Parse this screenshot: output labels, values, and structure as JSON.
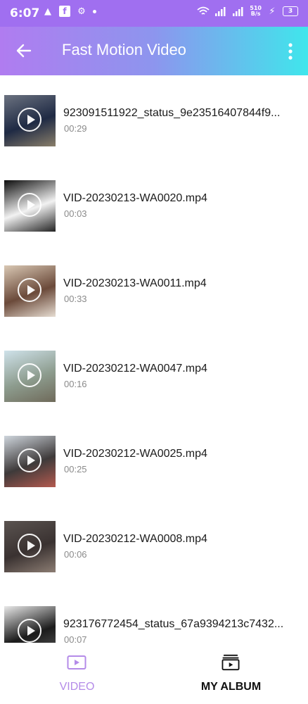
{
  "status_bar": {
    "time": "6:07",
    "net_speed_value": "510",
    "net_speed_unit": "B/s",
    "battery": "3"
  },
  "app_bar": {
    "title": "Fast Motion Video",
    "back_icon": "arrow-left-icon",
    "menu_icon": "more-vertical-icon"
  },
  "videos": [
    {
      "name": "923091511922_status_9e23516407844f9...",
      "duration": "00:29",
      "thumb_colors": [
        "#6b7280",
        "#1f2a44",
        "#8a7f6a"
      ]
    },
    {
      "name": "VID-20230213-WA0020.mp4",
      "duration": "00:03",
      "thumb_colors": [
        "#0d0d0d",
        "#f2f2f2",
        "#222"
      ]
    },
    {
      "name": "VID-20230213-WA0011.mp4",
      "duration": "00:33",
      "thumb_colors": [
        "#d9c8b4",
        "#6b4a3a",
        "#e7ddd2"
      ]
    },
    {
      "name": "VID-20230212-WA0047.mp4",
      "duration": "00:16",
      "thumb_colors": [
        "#cfe2ea",
        "#8d9c8e",
        "#6f6a5a"
      ]
    },
    {
      "name": "VID-20230212-WA0025.mp4",
      "duration": "00:25",
      "thumb_colors": [
        "#cfd6dd",
        "#3e3a3a",
        "#b45a4f"
      ]
    },
    {
      "name": "VID-20230212-WA0008.mp4",
      "duration": "00:06",
      "thumb_colors": [
        "#5a5350",
        "#3a3231",
        "#8c7d73"
      ]
    },
    {
      "name": "923176772454_status_67a9394213c7432...",
      "duration": "00:07",
      "thumb_colors": [
        "#e9e9e9",
        "#1b1b1b",
        "#5a5a5a"
      ]
    }
  ],
  "bottom_nav": {
    "tabs": [
      {
        "label": "VIDEO",
        "icon": "video-play-icon",
        "active": true
      },
      {
        "label": "MY ALBUM",
        "icon": "album-icon",
        "active": false
      }
    ]
  },
  "colors": {
    "accent_purple": "#b07cf0",
    "accent_cyan": "#3fe6ec",
    "active_tab": "#b48be8"
  }
}
